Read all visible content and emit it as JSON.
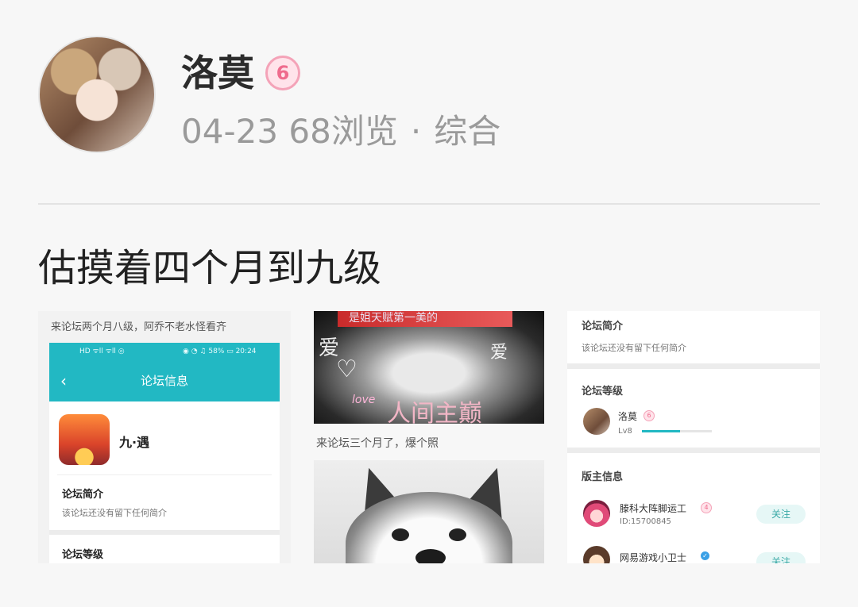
{
  "author": {
    "name": "洛莫",
    "level_badge": "6"
  },
  "post_meta": {
    "date": "04-23",
    "views": "68浏览",
    "separator": "·",
    "category": "综合"
  },
  "post": {
    "title": "估摸着四个月到九级"
  },
  "images": {
    "left": {
      "caption": "来论坛两个月八级，阿乔不老水怪看齐",
      "status_left": "HD ᯤll ᯤll ◎",
      "status_right": "◉ ◔ ♫ 58% ▭ 20:24",
      "screen_title": "论坛信息",
      "back": "‹",
      "game_name": "九·遇",
      "intro_heading": "论坛简介",
      "intro_text": "该论坛还没有留下任何简介",
      "level_heading": "论坛等级"
    },
    "middle_top": {
      "top_text": "是姐天赋第一美的",
      "love_left": "爱",
      "love_right": "爱",
      "heart": "♡",
      "love_en": "love",
      "bottom_text": "人间主巅"
    },
    "middle_caption": "来论坛三个月了，爆个照",
    "right": {
      "intro_heading": "论坛简介",
      "intro_text": "该论坛还没有留下任何简介",
      "level_heading": "论坛等级",
      "user_name": "洛莫",
      "user_badge": "6",
      "user_level": "Lv8",
      "user_progress": 0.55,
      "mod_heading": "版主信息",
      "mod1_name": "滕科大阵脚运工",
      "mod1_badge": "4",
      "mod1_id": "ID:15700845",
      "mod1_follow": "关注",
      "mod2_name": "网易游戏小卫士",
      "mod2_follow": "关注"
    }
  }
}
